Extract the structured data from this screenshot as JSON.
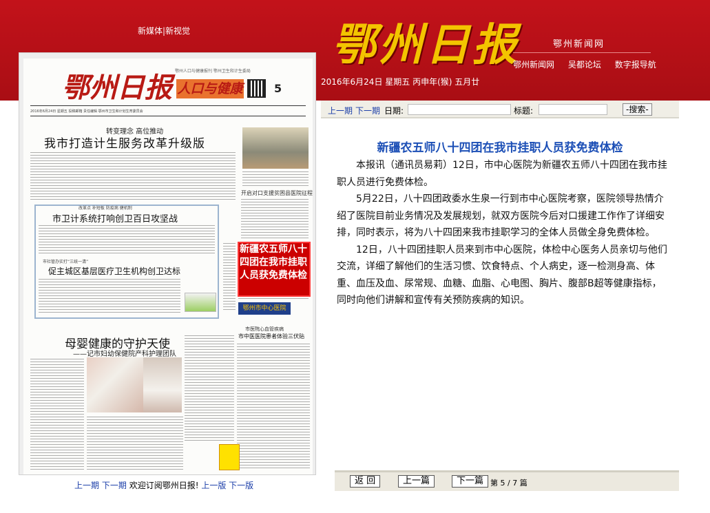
{
  "header": {
    "left_links": "新媒体|新视觉",
    "logo": "鄂州日报",
    "site_name": "鄂州新闻网",
    "site_links": [
      "鄂州新闻网",
      "吴都论坛",
      "数字报导航"
    ],
    "date": "2016年6月24日 星期五 丙申年(猴) 五月廿"
  },
  "paper": {
    "masthead": "鄂州日报",
    "section_name": "人口与健康",
    "page_no": "5",
    "masthead_small": "鄂州人口与健康报刊 鄂州卫生和计生委局",
    "info_line": "2016年6月24日 星期五 投稿邮箱 责任编辑 鄂州市卫生和计划生育委员会",
    "kicker1": "转变理念  高位推动",
    "headline1": "我市打造计生服务改革升级版",
    "kicker2": "改革点 补短板 防疫病 健机制",
    "headline2": "市卫计系统打响创卫百日攻坚战",
    "kicker3": "市社管办实打“三统一清”",
    "headline3": "促主城区基层医疗卫生机构创卫达标",
    "subhead_right": "开启对口支援贫困县医院征程",
    "highlight_text": "新疆农五师八十四团在我市挂职人员获免费体检",
    "logo2": "鄂州市中心医院",
    "subhead2": "市医院心血管疾病",
    "headline4": "市中医医院患者体验三伏贴",
    "headline5": "母婴健康的守护天使",
    "sub5": "——记市妇幼保健院产科护理团队"
  },
  "left_footer": {
    "prev_period": "上一期",
    "next_period": "下一期",
    "welcome": "欢迎订阅鄂州日报!",
    "prev_page": "上一版",
    "next_page": "下一版"
  },
  "nav": {
    "prev": "上一期",
    "next": "下一期",
    "date_label": "日期:",
    "title_label": "标题:",
    "search_button": "-搜索-"
  },
  "article": {
    "title": "新疆农五师八十四团在我市挂职人员获免费体检",
    "paragraphs": [
      "本报讯（通讯员易莉）12日，市中心医院为新疆农五师八十四团在我市挂职人员进行免费体检。",
      "5月22日，八十四团政委水生泉一行到市中心医院考察，医院领导热情介绍了医院目前业务情况及发展规划，就双方医院今后对口援建工作作了详细安排，同时表示，将为八十四团来我市挂职学习的全体人员做全身免费体检。",
      "12日，八十四团挂职人员来到市中心医院，体检中心医务人员亲切与他们交流，详细了解他们的生活习惯、饮食特点、个人病史，逐一检测身高、体重、血压及血、尿常规、血糖、血脂、心电图、胸片、腹部B超等健康指标，同时向他们讲解和宣传有关预防疾病的知识。"
    ]
  },
  "bottom": {
    "back": "返 回",
    "prev_article": "上一篇",
    "next_article": "下一篇",
    "page_prefix": "第",
    "current": "5",
    "sep": "/",
    "total": "7",
    "page_suffix": "篇"
  }
}
